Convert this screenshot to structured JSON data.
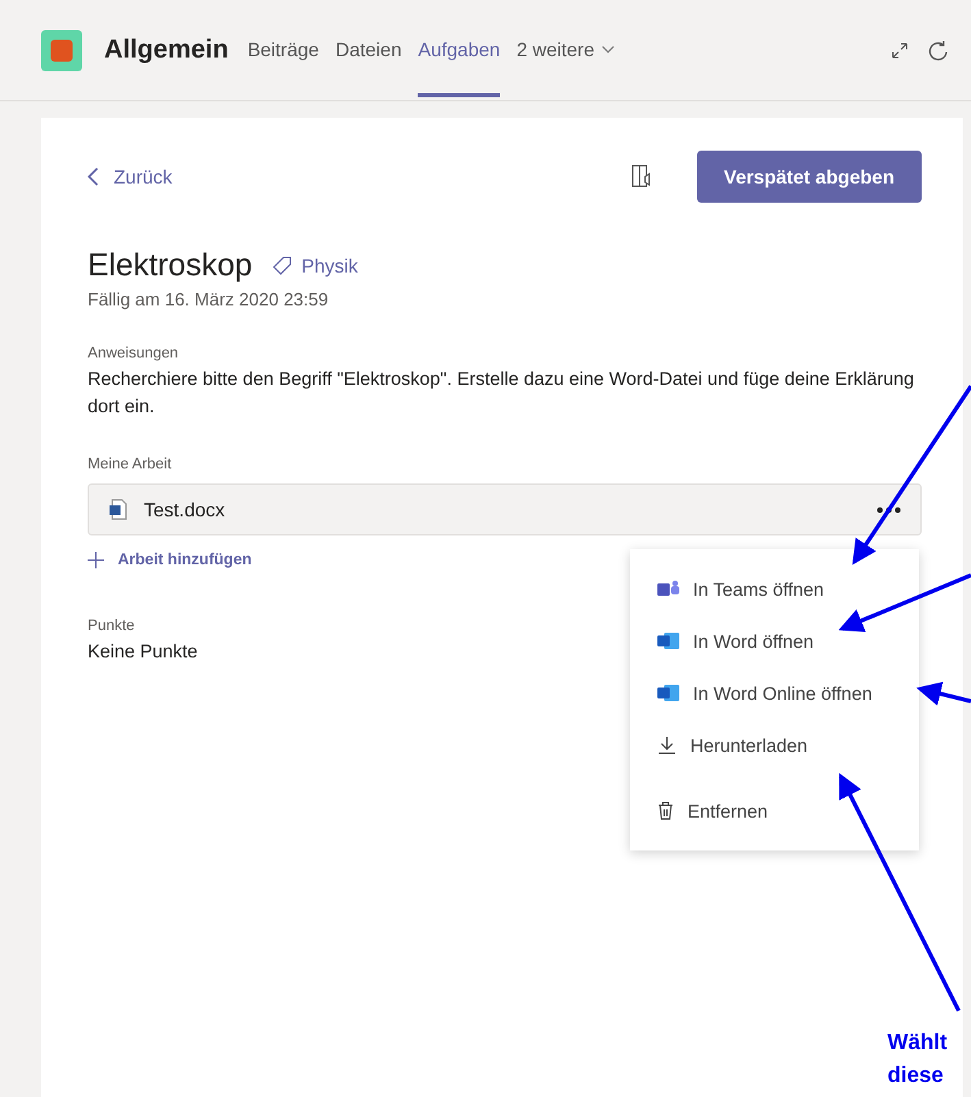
{
  "header": {
    "team_name": "Allgemein",
    "tabs": [
      {
        "label": "Beiträge",
        "selected": false
      },
      {
        "label": "Dateien",
        "selected": false
      },
      {
        "label": "Aufgaben",
        "selected": true
      }
    ],
    "more_tabs": "2 weitere"
  },
  "assignment": {
    "back": "Zurück",
    "submit": "Verspätet abgeben",
    "title": "Elektroskop",
    "tag": "Physik",
    "due": "Fällig am 16. März 2020 23:59",
    "instructions_label": "Anweisungen",
    "instructions": "Recherchiere bitte den Begriff \"Elektroskop\". Erstelle dazu eine Word-Datei und füge deine Erklärung dort ein.",
    "work_label": "Meine Arbeit",
    "file": "Test.docx",
    "add_work": "Arbeit hinzufügen",
    "points_label": "Punkte",
    "points": "Keine Punkte"
  },
  "menu": {
    "items": [
      {
        "kind": "teams",
        "label": "In Teams öffnen"
      },
      {
        "kind": "word",
        "label": "In Word öffnen"
      },
      {
        "kind": "word",
        "label": "In Word Online öffnen"
      },
      {
        "kind": "download",
        "label": "Herunterladen"
      },
      {
        "kind": "delete",
        "label": "Entfernen"
      }
    ]
  },
  "annotation": {
    "lines": [
      "Wählt",
      "diese"
    ]
  }
}
